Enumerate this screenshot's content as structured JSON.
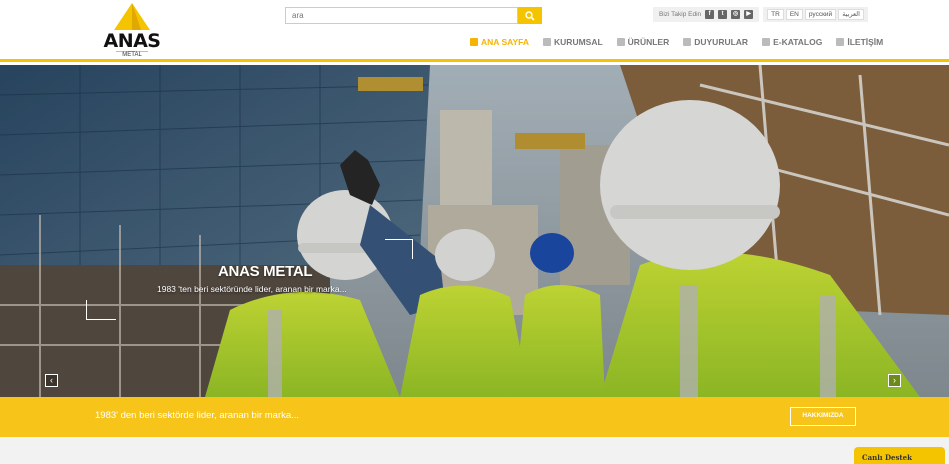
{
  "header": {
    "logo_text": "ANAS",
    "logo_sub": "METAL"
  },
  "search": {
    "placeholder": "ara"
  },
  "social": {
    "label": "Bizi Takip Edin",
    "icons": [
      "facebook-icon",
      "twitter-icon",
      "instagram-icon",
      "youtube-icon"
    ]
  },
  "languages": [
    "TR",
    "EN",
    "русский",
    "العربية"
  ],
  "nav": [
    {
      "label": "ANA SAYFA",
      "icon": "home-icon",
      "active": true
    },
    {
      "label": "KURUMSAL",
      "icon": "building-icon",
      "active": false
    },
    {
      "label": "ÜRÜNLER",
      "icon": "cubes-icon",
      "active": false
    },
    {
      "label": "DUYURULAR",
      "icon": "megaphone-icon",
      "active": false
    },
    {
      "label": "E-KATALOG",
      "icon": "book-icon",
      "active": false
    },
    {
      "label": "İLETİŞİM",
      "icon": "globe-icon",
      "active": false
    }
  ],
  "hero": {
    "title": "ANAS METAL",
    "subtitle": "1983 'ten beri sektöründe lider, aranan bir marka...",
    "prev": "‹",
    "next": "›"
  },
  "band": {
    "text": "1983' den beri sektörde lider, aranan bir marka...",
    "button": "HAKKIMIZDA"
  },
  "live_support": "Canlı Destek",
  "colors": {
    "accent": "#f5c400",
    "band": "#f7c51a"
  }
}
